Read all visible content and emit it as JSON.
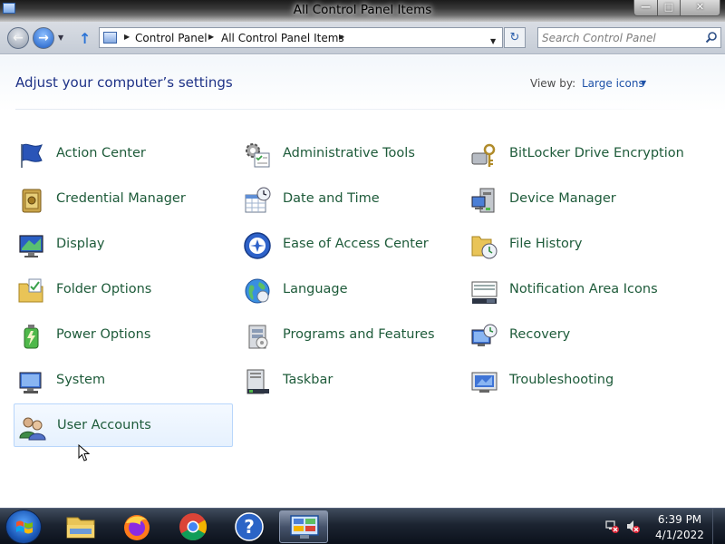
{
  "window": {
    "title": "All Control Panel Items",
    "minimize_icon": "minimize-icon",
    "maximize_icon": "maximize-icon",
    "close_icon": "close-icon"
  },
  "address_bar": {
    "breadcrumbs": [
      "Control Panel",
      "All Control Panel Items"
    ],
    "search_placeholder": "Search Control Panel"
  },
  "header": {
    "title": "Adjust your computer’s settings",
    "view_by_label": "View by:",
    "view_by_value": "Large icons"
  },
  "items": [
    {
      "label": "Action Center",
      "icon": "action-center-flag-icon"
    },
    {
      "label": "Administrative Tools",
      "icon": "administrative-tools-icon"
    },
    {
      "label": "BitLocker Drive Encryption",
      "icon": "bitlocker-keys-icon"
    },
    {
      "label": "Credential Manager",
      "icon": "credential-vault-icon"
    },
    {
      "label": "Date and Time",
      "icon": "calendar-clock-icon"
    },
    {
      "label": "Device Manager",
      "icon": "device-manager-icon"
    },
    {
      "label": "Display",
      "icon": "display-monitor-icon"
    },
    {
      "label": "Ease of Access Center",
      "icon": "ease-of-access-icon"
    },
    {
      "label": "File History",
      "icon": "file-history-icon"
    },
    {
      "label": "Folder Options",
      "icon": "folder-options-icon"
    },
    {
      "label": "Language",
      "icon": "language-globe-icon"
    },
    {
      "label": "Notification Area Icons",
      "icon": "notification-area-icon"
    },
    {
      "label": "Power Options",
      "icon": "power-options-icon"
    },
    {
      "label": "Programs and Features",
      "icon": "programs-features-icon"
    },
    {
      "label": "Recovery",
      "icon": "recovery-icon"
    },
    {
      "label": "System",
      "icon": "system-icon"
    },
    {
      "label": "Taskbar",
      "icon": "taskbar-icon"
    },
    {
      "label": "Troubleshooting",
      "icon": "troubleshooting-icon"
    },
    {
      "label": "User Accounts",
      "icon": "user-accounts-icon",
      "selected": true
    }
  ],
  "taskbar": {
    "apps": [
      "file-explorer-icon",
      "firefox-icon",
      "chrome-icon",
      "help-icon",
      "control-panel-icon"
    ],
    "active_app": "control-panel-icon",
    "clock_time": "6:39 PM",
    "clock_date": "4/1/2022"
  },
  "colors": {
    "item_label": "#1e5b3a",
    "page_title": "#1e3287",
    "link": "#1e52a8",
    "selection_border": "#b8d6fb"
  }
}
